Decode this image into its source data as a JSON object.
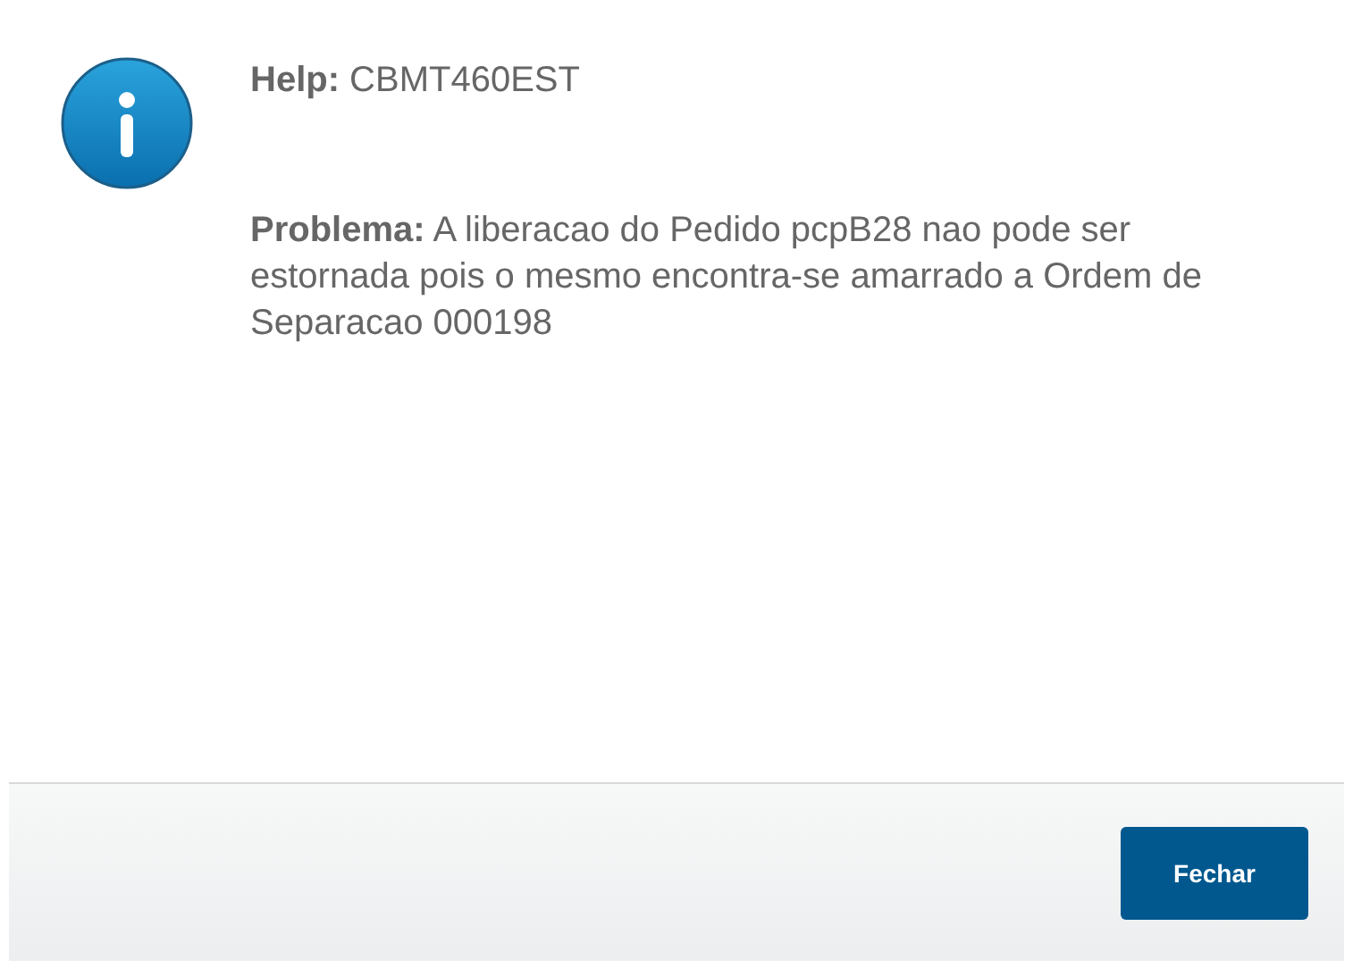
{
  "help": "**Help:** CBMT460EST",
  "problem": "**Problema:** A liberacao do Pedido pcpB28 nao pode ser estornada pois o mesmo encontra-se amarrado a Ordem de Separacao 000198",
  "buttons": [
    "Fechar"
  ]
}
